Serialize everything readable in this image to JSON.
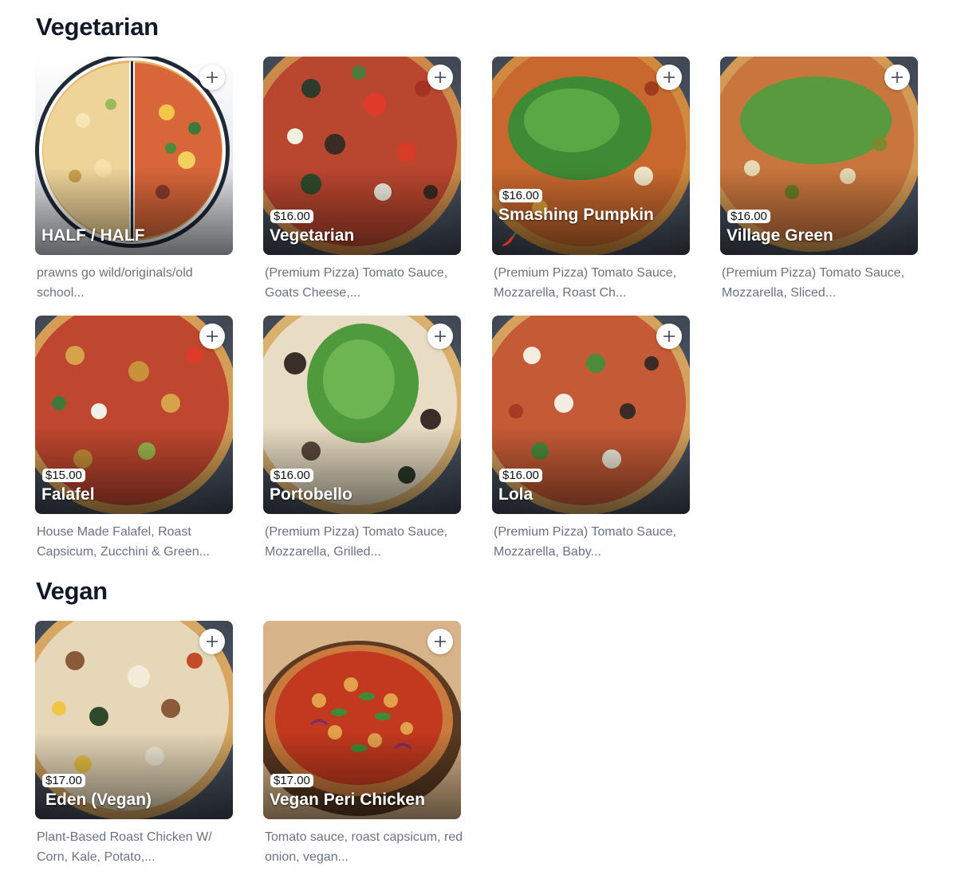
{
  "sections": [
    {
      "title": "Vegetarian"
    },
    {
      "title": "Vegan"
    }
  ],
  "items": [
    {
      "name": "HALF / HALF",
      "price": "",
      "description": "prawns go wild/originals/old school..."
    },
    {
      "name": "Vegetarian",
      "price": "$16.00",
      "description": "(Premium Pizza) Tomato Sauce, Goats Cheese,..."
    },
    {
      "name": "Smashing Pumpkin",
      "price": "$16.00",
      "description": "(Premium Pizza) Tomato Sauce, Mozzarella, Roast Ch...",
      "spicy": true
    },
    {
      "name": "Village Green",
      "price": "$16.00",
      "description": "(Premium Pizza) Tomato Sauce, Mozzarella, Sliced..."
    },
    {
      "name": "Falafel",
      "price": "$15.00",
      "description": "House Made Falafel, Roast Capsicum, Zucchini & Green..."
    },
    {
      "name": "Portobello",
      "price": "$16.00",
      "description": "(Premium Pizza) Tomato Sauce, Mozzarella, Grilled..."
    },
    {
      "name": "Lola",
      "price": "$16.00",
      "description": "(Premium Pizza) Tomato Sauce, Mozzarella, Baby..."
    },
    {
      "name": "Eden (Vegan)",
      "price": "$17.00",
      "description": " Plant-Based Roast Chicken W/ Corn, Kale, Potato,..."
    },
    {
      "name": "Vegan Peri Chicken",
      "price": "$17.00",
      "description": "Tomato sauce, roast capsicum, red onion, vegan..."
    }
  ],
  "icons": {
    "add": "plus-icon",
    "spicy": "chili-icon"
  }
}
